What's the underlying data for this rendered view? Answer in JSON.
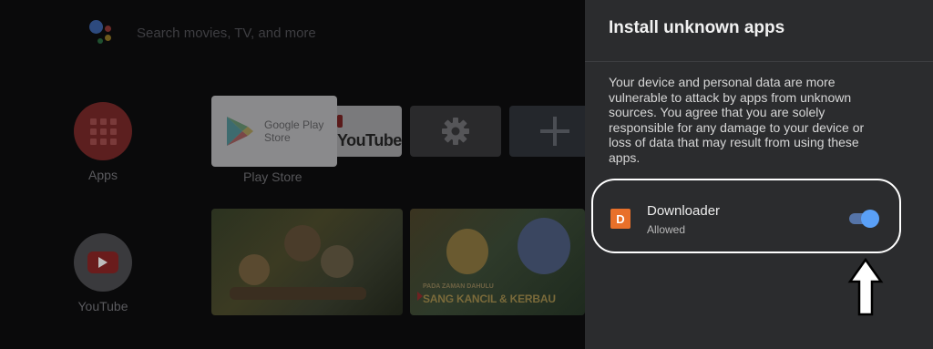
{
  "home": {
    "search_placeholder": "Search movies, TV, and more",
    "sidebar": {
      "apps_label": "Apps",
      "youtube_label": "YouTube"
    },
    "tiles": {
      "play_store_tile_text": "Google Play Store",
      "play_store_caption": "Play Store",
      "youtube_tile_text": "YouTube"
    },
    "videos": {
      "video2_small_caption": "PADA ZAMAN DAHULU",
      "video2_caption": "SANG KANCIL & KERBAU"
    }
  },
  "panel": {
    "title": "Install unknown apps",
    "description": "Your device and personal data are more vulnerable to attack by apps from unknown sources. You agree that you are solely responsible for any damage to your device or loss of data that may result from using these apps.",
    "apps": [
      {
        "name": "Downloader",
        "status": "Allowed",
        "icon": "downloader-app-icon",
        "enabled": true
      }
    ]
  },
  "colors": {
    "panel_bg": "#2b2c2e",
    "toggle_on": "#5aa0f7",
    "downloader_orange": "#e8702a"
  }
}
